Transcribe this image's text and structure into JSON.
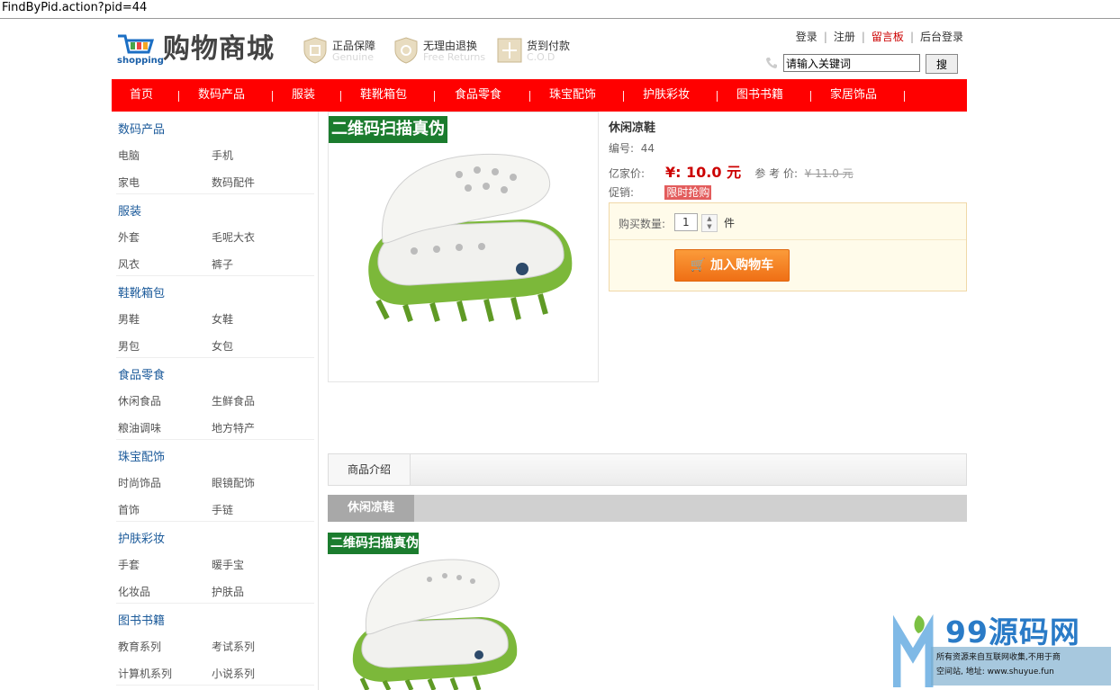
{
  "browser": {
    "url": "FindByPid.action?pid=44"
  },
  "header": {
    "logo_sub": "shopping",
    "logo_title": "购物商城",
    "promises": [
      {
        "title": "正品保障",
        "sub": "Genuine"
      },
      {
        "title": "无理由退换",
        "sub": "Free Returns"
      },
      {
        "title": "货到付款",
        "sub": "C.O.D"
      }
    ],
    "links": [
      "登录",
      "注册",
      "留言板",
      "后台登录"
    ],
    "search": {
      "value": "请输入关键词",
      "button": "搜"
    }
  },
  "nav": [
    "首页",
    "数码产品",
    "服装",
    "鞋靴箱包",
    "食品零食",
    "珠宝配饰",
    "护肤彩妆",
    "图书书籍",
    "家居饰品"
  ],
  "sidebar": [
    {
      "title": "数码产品",
      "items": [
        "电脑",
        "手机",
        "家电",
        "数码配件"
      ]
    },
    {
      "title": "服装",
      "items": [
        "外套",
        "毛呢大衣",
        "风衣",
        "裤子"
      ]
    },
    {
      "title": "鞋靴箱包",
      "items": [
        "男鞋",
        "女鞋",
        "男包",
        "女包"
      ]
    },
    {
      "title": "食品零食",
      "items": [
        "休闲食品",
        "生鲜食品",
        "粮油调味",
        "地方特产"
      ]
    },
    {
      "title": "珠宝配饰",
      "items": [
        "时尚饰品",
        "眼镜配饰",
        "首饰",
        "手链"
      ]
    },
    {
      "title": "护肤彩妆",
      "items": [
        "手套",
        "暖手宝",
        "化妆品",
        "护肤品"
      ]
    },
    {
      "title": "图书书籍",
      "items": [
        "教育系列",
        "考试系列",
        "计算机系列",
        "小说系列"
      ]
    }
  ],
  "product": {
    "badge": "二维码扫描真伪",
    "name": "休闲凉鞋",
    "id_label": "编号:",
    "id": "44",
    "price_label": "亿家价:",
    "price": "¥: 10.0 元",
    "ref_label": "参 考 价:",
    "ref_price": "¥ 11.0 元",
    "promo_label": "促销:",
    "promo": "限时抢购",
    "qty_label": "购买数量:",
    "qty": "1",
    "unit": "件",
    "cart_button": "加入购物车"
  },
  "detail": {
    "tab": "商品介绍",
    "title": "休闲凉鞋",
    "badge": "二维码扫描真伪"
  },
  "watermark": {
    "brand": "99源码网",
    "line1": "所有资源来自互联网收集,不用于商",
    "line2": "空间站",
    "line3": "地址: www.shuyue.fun"
  }
}
